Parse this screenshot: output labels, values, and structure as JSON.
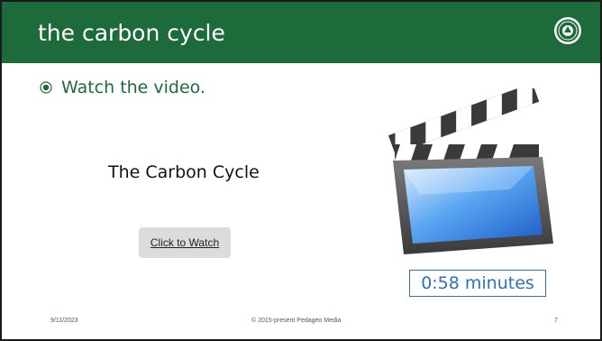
{
  "slide": {
    "title": "the carbon cycle",
    "bullet": "Watch the video.",
    "video_title": "The Carbon Cycle",
    "watch_link": "Click to Watch",
    "duration": "0:58 minutes"
  },
  "footer": {
    "date": "9/11/2023",
    "copyright": "© 2015-present Pedageo Media",
    "page_number": "7"
  },
  "icons": {
    "logo": "school-seal-icon",
    "bullet": "radio-bullet-icon",
    "media": "film-clapperboard-icon"
  },
  "colors": {
    "title_bar": "#1d6b3a",
    "accent_text": "#1d6b3a",
    "duration_border": "#2f72b8"
  }
}
